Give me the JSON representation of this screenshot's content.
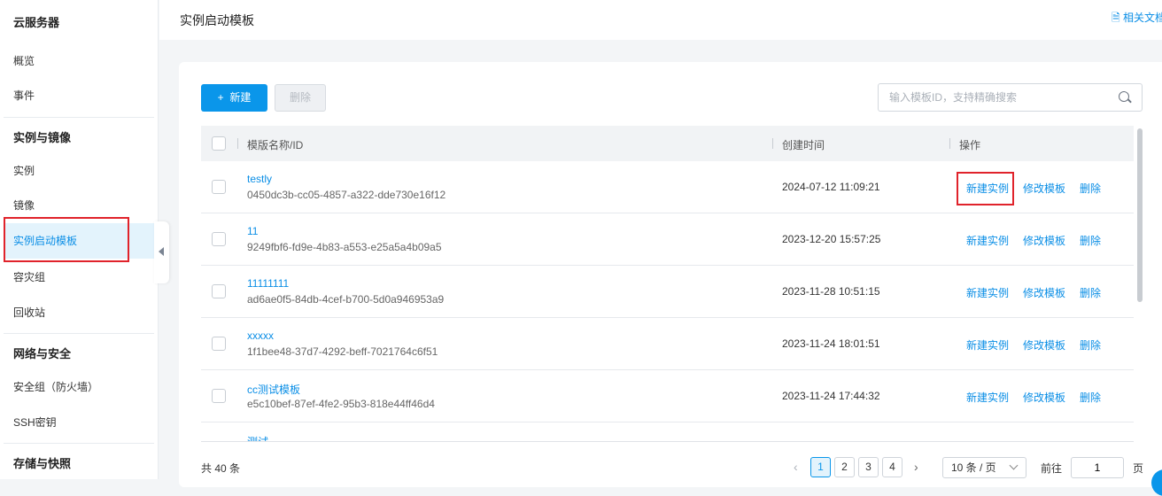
{
  "sidebar": {
    "title": "云服务器",
    "items": [
      {
        "label": "概览"
      },
      {
        "label": "事件"
      }
    ],
    "sections": [
      {
        "title": "实例与镜像",
        "items": [
          {
            "label": "实例"
          },
          {
            "label": "镜像"
          },
          {
            "label": "实例启动模板"
          },
          {
            "label": "容灾组"
          },
          {
            "label": "回收站"
          }
        ]
      },
      {
        "title": "网络与安全",
        "items": [
          {
            "label": "安全组（防火墙）"
          },
          {
            "label": "SSH密钥"
          }
        ]
      },
      {
        "title": "存储与快照"
      }
    ]
  },
  "header": {
    "title": "实例启动模板",
    "doc_link": "相关文档"
  },
  "toolbar": {
    "new_label": "+  新建",
    "delete_label": "删除",
    "search_placeholder": "输入模板ID，支持精确搜索"
  },
  "table": {
    "columns": [
      "模版名称/ID",
      "创建时间",
      "操作"
    ],
    "actions": [
      "新建实例",
      "修改模板",
      "删除"
    ],
    "rows": [
      {
        "name": "testly",
        "id": "0450dc3b-cc05-4857-a322-dde730e16f12",
        "created": "2024-07-12 11:09:21"
      },
      {
        "name": "11",
        "id": "9249fbf6-fd9e-4b83-a553-e25a5a4b09a5",
        "created": "2023-12-20 15:57:25"
      },
      {
        "name": "11111111",
        "id": "ad6ae0f5-84db-4cef-b700-5d0a946953a9",
        "created": "2023-11-28 10:51:15"
      },
      {
        "name": "xxxxx",
        "id": "1f1bee48-37d7-4292-beff-7021764c6f51",
        "created": "2023-11-24 18:01:51"
      },
      {
        "name": "cc测试模板",
        "id": "e5c10bef-87ef-4fe2-95b3-818e44ff46d4",
        "created": "2023-11-24 17:44:32"
      },
      {
        "name": "测试",
        "id": "",
        "created": ""
      }
    ]
  },
  "pagination": {
    "total": "共 40 条",
    "pages": [
      "1",
      "2",
      "3",
      "4"
    ],
    "current": "1",
    "page_size": "10 条 / 页",
    "goto_label": "前往",
    "goto_value": "1",
    "page_unit": "页"
  }
}
